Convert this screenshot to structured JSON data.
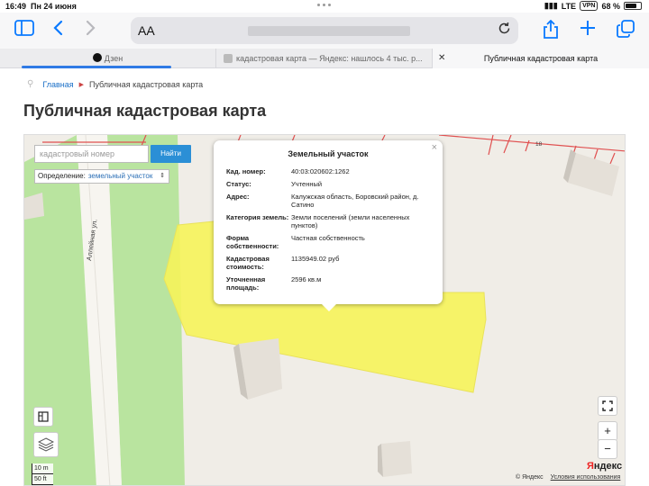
{
  "status_bar": {
    "time": "16:49",
    "date": "Пн 24 июня",
    "carrier": "LTE",
    "vpn": "VPN",
    "battery": "68 %"
  },
  "toolbar": {
    "text_size": "AA"
  },
  "tabs": [
    {
      "label": "Дзен"
    },
    {
      "label": "кадастровая карта — Яндекс: нашлось 4 тыс. р..."
    },
    {
      "label": "Публичная кадастровая карта"
    }
  ],
  "breadcrumb": {
    "home": "Главная",
    "current": "Публичная кадастровая карта"
  },
  "page_title": "Публичная кадастровая карта",
  "map": {
    "search_placeholder": "кадастровый номер",
    "find_button": "Найти",
    "definition_label": "Определение:",
    "definition_value": "земельный участок",
    "street_label": "Аллейная ул.",
    "house_number": "18",
    "scale_top": "10 m",
    "scale_bottom": "50 ft",
    "copyright": "© Яндекс",
    "terms": "Условия использования",
    "logo_y": "Я",
    "logo_rest": "ндекс"
  },
  "popup": {
    "title": "Земельный участок",
    "rows": [
      {
        "key": "Кад. номер:",
        "value": "40:03:020602:1262"
      },
      {
        "key": "Статус:",
        "value": "Учтенный"
      },
      {
        "key": "Адрес:",
        "value": "Калужская область, Боровский район, д. Сатино"
      },
      {
        "key": "Категория земель:",
        "value": "Земли поселений (земли населенных пунктов)"
      },
      {
        "key": "Форма собственности:",
        "value": "Частная собственность"
      },
      {
        "key": "Кадастровая стоимость:",
        "value": "1135949.02 руб"
      },
      {
        "key": "Уточненная площадь:",
        "value": "2596 кв.м"
      }
    ]
  },
  "colors": {
    "accent": "#0a7aff",
    "parcel": "#f6f35a",
    "green_area": "#b9e49f",
    "button": "#2b8fd6"
  }
}
